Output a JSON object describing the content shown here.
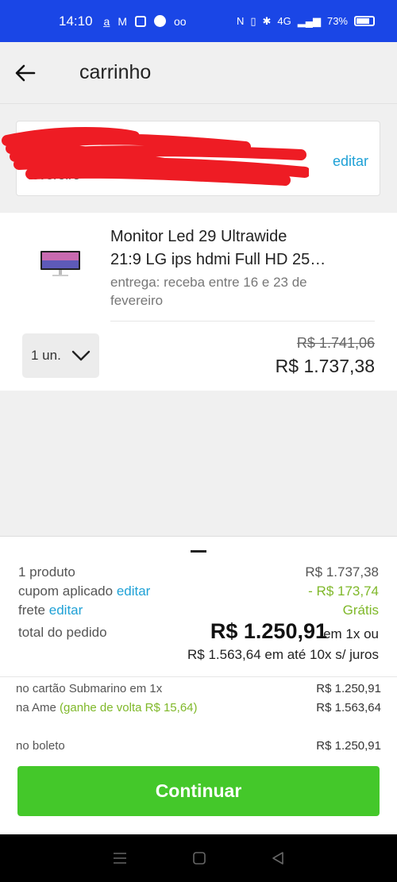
{
  "status_bar": {
    "time": "14:10",
    "battery": "73%",
    "signal": "4G"
  },
  "header": {
    "title": "carrinho"
  },
  "address": {
    "line1": "",
    "line2": "fevereiro",
    "edit_label": "editar"
  },
  "product": {
    "title_line1": "Monitor Led 29 Ultrawide",
    "title_line2": "21:9 LG ips hdmi Full HD 25…",
    "delivery": "entrega: receba entre 16 e 23 de fevereiro",
    "quantity": "1 un.",
    "old_price": "R$ 1.741,06",
    "price": "R$ 1.737,38"
  },
  "summary": {
    "items_label": "1 produto",
    "items_value": "R$ 1.737,38",
    "coupon_label": "cupom aplicado",
    "coupon_edit": "editar",
    "coupon_value": "- R$ 173,74",
    "shipping_label": "frete",
    "shipping_edit": "editar",
    "shipping_value": "Grátis",
    "total_label": "total do pedido",
    "total_value": "R$ 1.250,91",
    "total_suffix": "em 1x ou",
    "installments": "R$ 1.563,64 em até 10x s/ juros"
  },
  "payment": {
    "card_label": "no cartão Submarino em 1x",
    "card_value": "R$ 1.250,91",
    "ame_label": "na Ame",
    "ame_cashback": "(ganhe de volta R$ 15,64)",
    "ame_value": "R$ 1.563,64",
    "boleto_label": "no boleto",
    "boleto_value": "R$ 1.250,91"
  },
  "cta": {
    "label": "Continuar"
  },
  "colors": {
    "status_bar": "#1a46e6",
    "link": "#1fa1d6",
    "discount_green": "#7fb829",
    "cta_green": "#44c82a",
    "redaction": "#ee1c24"
  }
}
